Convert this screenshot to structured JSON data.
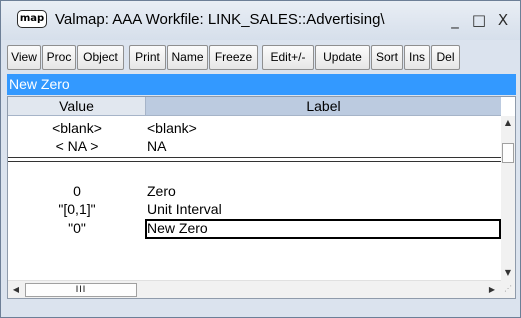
{
  "window": {
    "app_icon_label": "map",
    "title": "Valmap: AAA   Workfile: LINK_SALES::Advertising\\",
    "minimize_glyph": "_",
    "maximize_glyph": "□",
    "close_glyph": "X"
  },
  "toolbar": {
    "buttons": [
      "View",
      "Proc",
      "Object",
      "Print",
      "Name",
      "Freeze",
      "Edit+/-",
      "Update",
      "Sort",
      "Ins",
      "Del"
    ]
  },
  "edit_field": {
    "value": "New Zero"
  },
  "grid": {
    "columns": [
      "Value",
      "Label"
    ],
    "rows": [
      {
        "value": "<blank>",
        "label": "<blank>"
      },
      {
        "value": "< NA >",
        "label": "NA"
      },
      {
        "value": "0",
        "label": "Zero"
      },
      {
        "value": "\"[0,1]\"",
        "label": "Unit Interval"
      },
      {
        "value": "\"0\"",
        "label": "New Zero"
      }
    ],
    "selected_row": 4,
    "selected_column": "Label"
  },
  "scrollbars": {
    "up_arrow": "▲",
    "down_arrow": "▼",
    "left_arrow": "◀",
    "right_arrow": "▶",
    "h_thumb_grip": "III"
  }
}
